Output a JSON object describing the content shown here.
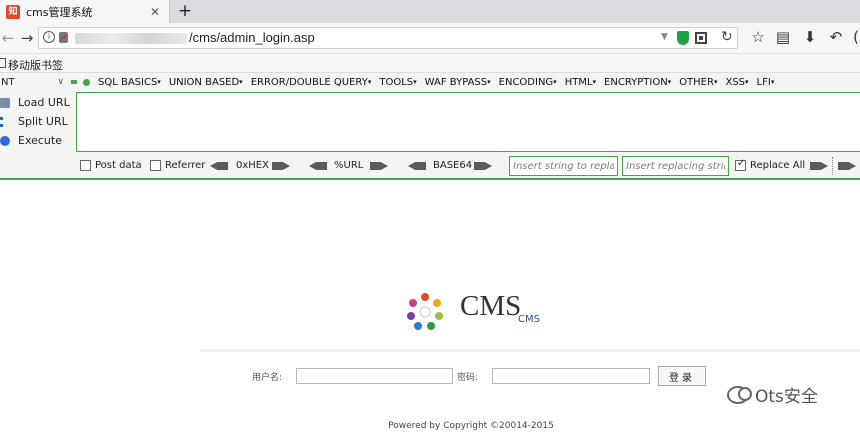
{
  "browser": {
    "tab_title": "cms管理系统",
    "tab_favicon": "知",
    "tab_close": "✕",
    "new_tab": "+",
    "url": "/cms/admin_login.asp"
  },
  "bookmarks": {
    "mobile_bookmarks": "移动版书签"
  },
  "hackbar": {
    "select_value": "NT",
    "menu": [
      "SQL BASICS",
      "UNION BASED",
      "ERROR/DOUBLE QUERY",
      "TOOLS",
      "WAF BYPASS",
      "ENCODING",
      "HTML",
      "ENCRYPTION",
      "OTHER",
      "XSS",
      "LFI"
    ],
    "actions": {
      "load": "Load URL",
      "split": "Split URL",
      "execute": "Execute"
    },
    "post_data": "Post data",
    "referrer": "Referrer",
    "hex": "0xHEX",
    "url_enc": "%URL",
    "base64": "BASE64",
    "insert_placeholder": "Insert string to replace",
    "replacing_placeholder": "Insert replacing string",
    "replace_all": "Replace All"
  },
  "page": {
    "logo_text": "CMS",
    "logo_sub": "CMS",
    "username_label": "用户名:",
    "password_label": "密码:",
    "login_button": "登录",
    "footer": "Powered by Copyright ©20014-2015",
    "watermark": "Ots安全"
  },
  "colors": {
    "hackbar_accent": "#47a447",
    "favicon": "#e8462b"
  }
}
